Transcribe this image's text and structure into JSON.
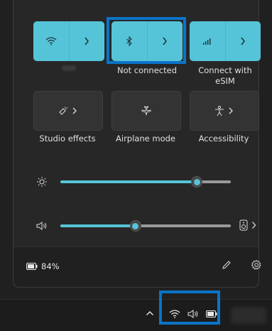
{
  "quick_settings": {
    "tiles_top": [
      {
        "id": "wifi",
        "label": "",
        "state": "on",
        "icon": "wifi-icon"
      },
      {
        "id": "bluetooth",
        "label": "Not connected",
        "state": "on",
        "icon": "bluetooth-icon"
      },
      {
        "id": "cellular",
        "label": "Connect with eSIM",
        "state": "on",
        "icon": "cellular-signal-icon"
      }
    ],
    "tiles_bottom": [
      {
        "id": "studio-effects",
        "label": "Studio effects",
        "state": "off",
        "icon": "studio-effects-icon"
      },
      {
        "id": "airplane",
        "label": "Airplane mode",
        "state": "off",
        "icon": "airplane-icon"
      },
      {
        "id": "accessibility",
        "label": "Accessibility",
        "state": "off",
        "icon": "accessibility-icon"
      }
    ],
    "brightness": {
      "value_percent": 80,
      "icon": "brightness-icon"
    },
    "volume": {
      "value_percent": 44,
      "icon": "speaker-icon"
    },
    "battery": {
      "text": "84%",
      "icon": "battery-icon"
    }
  },
  "labels": {
    "bluetooth_status": "Not connected",
    "cellular_line1": "Connect with",
    "cellular_line2": "eSIM",
    "studio": "Studio effects",
    "airplane": "Airplane mode",
    "accessibility": "Accessibility",
    "battery_percent": "84%"
  },
  "colors": {
    "accent": "#56c4d8",
    "highlight": "#0a74c8"
  }
}
